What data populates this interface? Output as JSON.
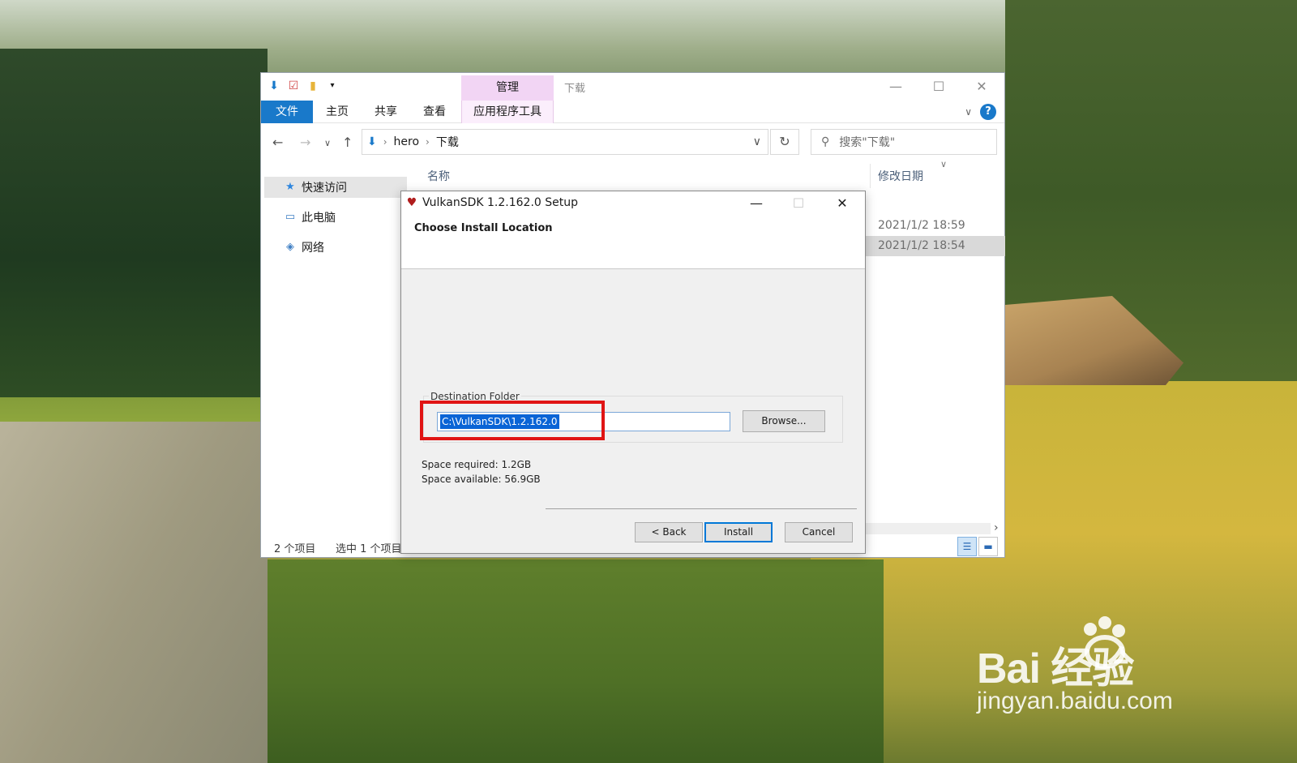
{
  "explorer": {
    "title": "下载",
    "context_tab_group": "管理",
    "tabs": [
      "文件",
      "主页",
      "共享",
      "查看",
      "应用程序工具"
    ],
    "address": {
      "parts": [
        "hero",
        "下载"
      ]
    },
    "search_placeholder": "搜索\"下载\"",
    "nav_items": [
      "快速访问",
      "此电脑",
      "网络"
    ],
    "columns": {
      "name": "名称",
      "date": "修改日期"
    },
    "rows": [
      {
        "date": "2021/1/2 18:59",
        "selected": false
      },
      {
        "date": "2021/1/2 18:54",
        "selected": true
      }
    ],
    "status": {
      "count": "2 个项目",
      "selected": "选中 1 个项目"
    }
  },
  "setup": {
    "title": "VulkanSDK 1.2.162.0 Setup",
    "heading": "Choose Install Location",
    "dest_label": "Destination Folder",
    "dest_value": "C:\\VulkanSDK\\1.2.162.0",
    "browse_label": "Browse...",
    "space_required": "Space required: 1.2GB",
    "space_available": "Space available: 56.9GB",
    "back_label": "< Back",
    "install_label": "Install",
    "cancel_label": "Cancel"
  },
  "watermark": {
    "brand": "Bai  经验",
    "url": "jingyan.baidu.com"
  },
  "colors": {
    "accent": "#1979ca",
    "context_tab": "#f2d5f4",
    "highlight": "#e01414",
    "selection": "#0a64d6"
  }
}
